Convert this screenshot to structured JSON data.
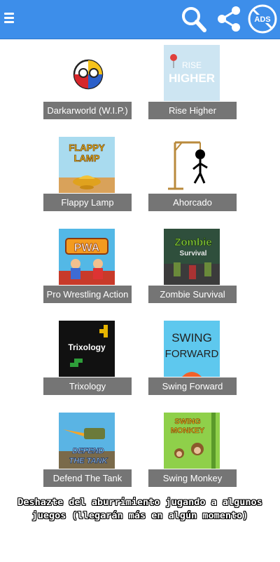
{
  "appbar": {
    "color": "#3d8eea",
    "icons": [
      "menu-icon",
      "search-icon",
      "share-icon",
      "ads-icon"
    ],
    "ads_label": "ADS"
  },
  "games": [
    {
      "title": "Darkarworld (W.I.P.)",
      "thumb": "darkarworld"
    },
    {
      "title": "Rise Higher",
      "thumb": "rise-higher",
      "thumb_text_1": "RISE",
      "thumb_text_2": "HIGHER"
    },
    {
      "title": "Flappy Lamp",
      "thumb": "flappy-lamp",
      "thumb_text_1": "FLAPPY",
      "thumb_text_2": "LAMP"
    },
    {
      "title": "Ahorcado",
      "thumb": "ahorcado"
    },
    {
      "title": "Pro Wrestling Action",
      "thumb": "pro-wrestling",
      "thumb_text_1": "PWA"
    },
    {
      "title": "Zombie Survival",
      "thumb": "zombie-survival",
      "thumb_text_1": "Zombie",
      "thumb_text_2": "Survival"
    },
    {
      "title": "Trixology",
      "thumb": "trixology",
      "thumb_text_1": "Trixology"
    },
    {
      "title": "Swing Forward",
      "thumb": "swing-forward",
      "thumb_text_1": "SWING",
      "thumb_text_2": "FORWARD"
    },
    {
      "title": "Defend The Tank",
      "thumb": "defend-the-tank",
      "thumb_text_1": "DEFEND",
      "thumb_text_2": "THE TANK"
    },
    {
      "title": "Swing Monkey",
      "thumb": "swing-monkey",
      "thumb_text_1": "SWING",
      "thumb_text_2": "MONKEY"
    }
  ],
  "footer": {
    "line1": "Deshazte del aburrimiento jugando a algunos",
    "line2": "juegos (llegarán más en algún momento)"
  }
}
